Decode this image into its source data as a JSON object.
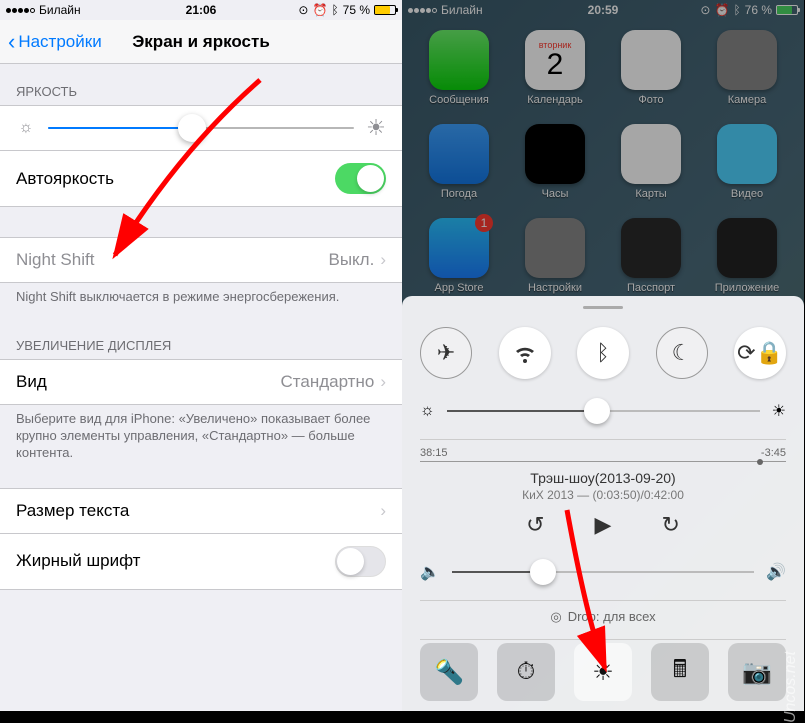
{
  "left": {
    "status": {
      "carrier": "Билайн",
      "time": "21:06",
      "battery": "75 %"
    },
    "nav": {
      "back": "Настройки",
      "title": "Экран и яркость"
    },
    "brightness_header": "ЯРКОСТЬ",
    "auto_brightness": "Автояркость",
    "night_shift": {
      "label": "Night Shift",
      "value": "Выкл."
    },
    "night_shift_footer": "Night Shift выключается в режиме энергосбережения.",
    "zoom_header": "УВЕЛИЧЕНИЕ ДИСПЛЕЯ",
    "zoom_row": {
      "label": "Вид",
      "value": "Стандартно"
    },
    "zoom_footer": "Выберите вид для iPhone: «Увеличено» показывает более крупно элементы управления, «Стандартно» — больше контента.",
    "text_size": "Размер текста",
    "bold_text": "Жирный шрифт"
  },
  "right": {
    "status": {
      "carrier": "Билайн",
      "time": "20:59",
      "battery": "76 %"
    },
    "apps": [
      {
        "label": "Сообщения",
        "color": "linear-gradient(#6cf36c,#0bd60b)"
      },
      {
        "label": "Календарь",
        "color": "#fff"
      },
      {
        "label": "Фото",
        "color": "#fff"
      },
      {
        "label": "Камера",
        "color": "#888"
      },
      {
        "label": "Погода",
        "color": "linear-gradient(#3ea1ff,#1478e6)"
      },
      {
        "label": "Часы",
        "color": "#000"
      },
      {
        "label": "Карты",
        "color": "#fff"
      },
      {
        "label": "Видео",
        "color": "#4fd3ff"
      },
      {
        "label": "App Store",
        "color": "linear-gradient(#2ac3ff,#1b7fff)"
      },
      {
        "label": "Настройки",
        "color": "#888"
      },
      {
        "label": "Пасспорт",
        "color": "#2a2a2a"
      },
      {
        "label": "Приложение",
        "color": "#222"
      }
    ],
    "calendar": {
      "day_name": "вторник",
      "day_num": "2"
    },
    "cc": {
      "elapsed": "38:15",
      "remaining": "-3:45",
      "track": "Трэш-шоу(2013-09-20)",
      "artist": "КиХ 2013 — (0:03:50)/0:42:00",
      "airdrop": "Drop: для всех"
    }
  },
  "watermark": "Uncos.net"
}
